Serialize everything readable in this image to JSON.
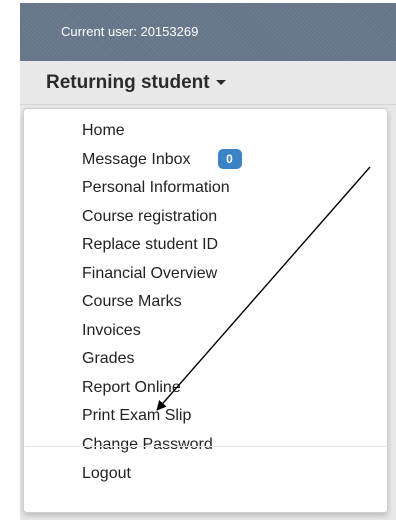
{
  "header": {
    "current_user": "Current user: 20153269",
    "role_label": "Returning student"
  },
  "menu": {
    "items": [
      {
        "label": "Home"
      },
      {
        "label": "Message Inbox",
        "badge": "0"
      },
      {
        "label": "Personal Information"
      },
      {
        "label": "Course registration"
      },
      {
        "label": "Replace student ID"
      },
      {
        "label": "Financial Overview"
      },
      {
        "label": "Course Marks"
      },
      {
        "label": "Invoices"
      },
      {
        "label": "Grades"
      },
      {
        "label": "Report Online"
      },
      {
        "label": "Print Exam Slip"
      },
      {
        "label": "Change Password"
      }
    ],
    "logout_label": "Logout"
  },
  "annotation": {
    "type": "arrow",
    "points_to": "Print Exam Slip"
  },
  "colors": {
    "user_bar_bg": "#66768a",
    "role_bar_bg": "#e8e8e8",
    "badge_bg": "#3c83c6",
    "menu_text": "#222222"
  }
}
